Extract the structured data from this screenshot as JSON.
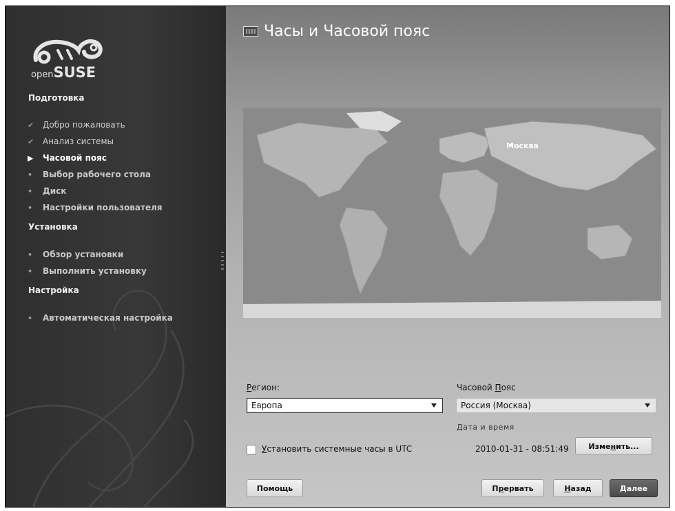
{
  "branding": {
    "logo_open": "open",
    "logo_suse": "SUSE"
  },
  "sidebar": {
    "sections": [
      {
        "title": "Подготовка",
        "steps": [
          {
            "label": "Добро пожаловать",
            "state": "done"
          },
          {
            "label": "Анализ системы",
            "state": "done"
          },
          {
            "label": "Часовой пояс",
            "state": "current"
          },
          {
            "label": "Выбор рабочего стола",
            "state": "future"
          },
          {
            "label": "Диск",
            "state": "future"
          },
          {
            "label": "Настройки пользователя",
            "state": "future"
          }
        ]
      },
      {
        "title": "Установка",
        "steps": [
          {
            "label": "Обзор установки",
            "state": "future"
          },
          {
            "label": "Выполнить установку",
            "state": "future"
          }
        ]
      },
      {
        "title": "Настройка",
        "steps": [
          {
            "label": "Автоматическая настройка",
            "state": "future"
          }
        ]
      }
    ],
    "icons": {
      "done": "check-icon",
      "current": "play-arrow-icon",
      "future": "bullet-icon"
    }
  },
  "main": {
    "title": "Часы и Часовой пояс",
    "title_icon": "clock-icon",
    "map": {
      "selected_city": "Москва"
    },
    "region": {
      "label_underlined": "Р",
      "label_rest": "егион:",
      "value": "Европа"
    },
    "timezone": {
      "label_pre": "Часовой ",
      "label_underlined": "П",
      "label_rest": "ояс",
      "value": "Россия (Москва)"
    },
    "datetime": {
      "label": "Дата и время",
      "value": "2010-01-31 - 08:51:49"
    },
    "utc": {
      "label_underlined": "У",
      "label_rest": "становить системные часы в UTC",
      "checked": false
    },
    "buttons": {
      "change_pre": "Изме",
      "change_underlined": "н",
      "change_rest": "ить...",
      "help": "Помощь",
      "abort_pre": "П",
      "abort_underlined": "р",
      "abort_rest": "ервать",
      "back_underlined": "Н",
      "back_rest": "азад",
      "next_underlined": "Д",
      "next_rest": "алее"
    }
  },
  "colors": {
    "sidebar_bg": "#333333",
    "primary_button": "#4a4a4a"
  }
}
